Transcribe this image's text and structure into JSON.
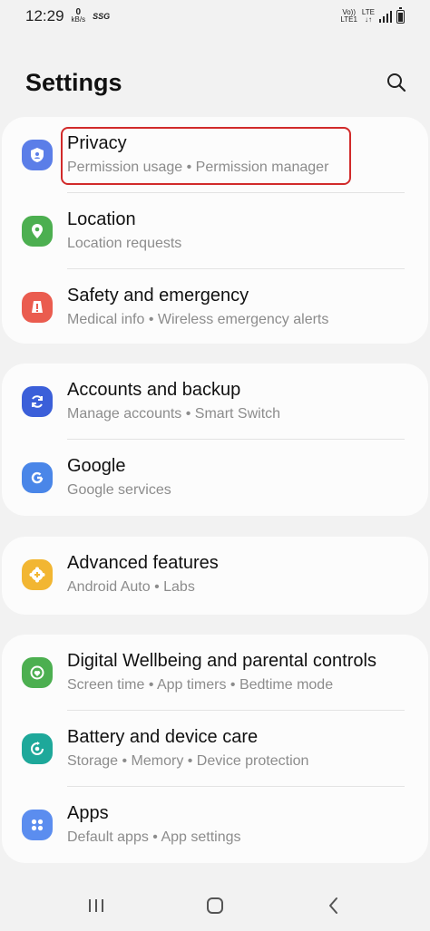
{
  "status_bar": {
    "time": "12:29",
    "net_speed_value": "0",
    "net_speed_unit": "kB/s",
    "carrier": "SSG",
    "volte_top": "Vo))",
    "volte_bottom": "LTE1",
    "lte_top": "LTE",
    "lte_bottom": "↓↑",
    "battery_level": 0.75
  },
  "header": {
    "title": "Settings",
    "search_icon": "search-icon"
  },
  "groups": [
    {
      "items": [
        {
          "title": "Privacy",
          "subtitle": "Permission usage  •  Permission manager",
          "icon": "shield-icon",
          "color": "#5b7ee8"
        },
        {
          "title": "Location",
          "subtitle": "Location requests",
          "icon": "location-pin-icon",
          "color": "#4caf50"
        },
        {
          "title": "Safety and emergency",
          "subtitle": "Medical info  •  Wireless emergency alerts",
          "icon": "alert-icon",
          "color": "#ea5c4f"
        }
      ]
    },
    {
      "items": [
        {
          "title": "Accounts and backup",
          "subtitle": "Manage accounts  •  Smart Switch",
          "icon": "sync-icon",
          "color": "#3b5fd9"
        },
        {
          "title": "Google",
          "subtitle": "Google services",
          "icon": "google-icon",
          "color": "#4a86e8"
        }
      ]
    },
    {
      "items": [
        {
          "title": "Advanced features",
          "subtitle": "Android Auto  •  Labs",
          "icon": "gear-plus-icon",
          "color": "#f2b632"
        }
      ]
    },
    {
      "items": [
        {
          "title": "Digital Wellbeing and parental controls",
          "subtitle": "Screen time  •  App timers  •  Bedtime mode",
          "icon": "wellbeing-icon",
          "color": "#4caf50"
        },
        {
          "title": "Battery and device care",
          "subtitle": "Storage  •  Memory  •  Device protection",
          "icon": "device-care-icon",
          "color": "#1ea89a"
        },
        {
          "title": "Apps",
          "subtitle": "Default apps  •  App settings",
          "icon": "apps-grid-icon",
          "color": "#5b8def"
        }
      ]
    }
  ],
  "nav_bar": {
    "recents_icon": "recents-icon",
    "home_icon": "home-icon",
    "back_icon": "back-icon"
  }
}
